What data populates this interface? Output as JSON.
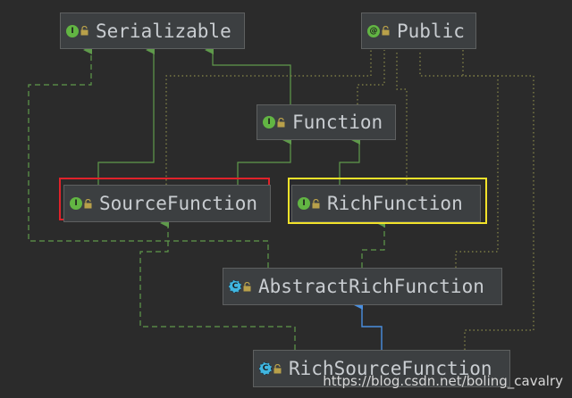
{
  "diagram": {
    "nodes": {
      "serializable": {
        "label": "Serializable",
        "kind": "interface",
        "kind_letter": "I"
      },
      "public": {
        "label": "Public",
        "kind": "annotation",
        "kind_letter": "@"
      },
      "function": {
        "label": "Function",
        "kind": "interface",
        "kind_letter": "I"
      },
      "source_function": {
        "label": "SourceFunction",
        "kind": "interface",
        "kind_letter": "I",
        "highlight": "red"
      },
      "rich_function": {
        "label": "RichFunction",
        "kind": "interface",
        "kind_letter": "I",
        "highlight": "yellow"
      },
      "abstract_rich_function": {
        "label": "AbstractRichFunction",
        "kind": "abstract_class",
        "kind_letter": "C"
      },
      "rich_source_function": {
        "label": "RichSourceFunction",
        "kind": "abstract_class",
        "kind_letter": "C"
      }
    },
    "edges": [
      {
        "from": "function",
        "to": "serializable",
        "style": "solid",
        "color": "#5f9a4b"
      },
      {
        "from": "source_function",
        "to": "serializable",
        "style": "solid",
        "color": "#5f9a4b"
      },
      {
        "from": "source_function",
        "to": "function",
        "style": "solid",
        "color": "#5f9a4b"
      },
      {
        "from": "rich_function",
        "to": "function",
        "style": "solid",
        "color": "#5f9a4b"
      },
      {
        "from": "abstract_rich_function",
        "to": "serializable",
        "style": "dashed",
        "color": "#5f9a4b"
      },
      {
        "from": "abstract_rich_function",
        "to": "rich_function",
        "style": "dashed",
        "color": "#5f9a4b"
      },
      {
        "from": "rich_source_function",
        "to": "source_function",
        "style": "dashed",
        "color": "#5f9a4b"
      },
      {
        "from": "rich_source_function",
        "to": "abstract_rich_function",
        "style": "solid",
        "color": "#4a8fe0"
      },
      {
        "from": "source_function",
        "to": "public",
        "style": "dotted",
        "color": "#8a8a4a"
      },
      {
        "from": "function",
        "to": "public",
        "style": "dotted",
        "color": "#8a8a4a"
      },
      {
        "from": "rich_function",
        "to": "public",
        "style": "dotted",
        "color": "#8a8a4a"
      },
      {
        "from": "abstract_rich_function",
        "to": "public",
        "style": "dotted",
        "color": "#8a8a4a"
      },
      {
        "from": "rich_source_function",
        "to": "public",
        "style": "dotted",
        "color": "#8a8a4a"
      }
    ],
    "colors": {
      "background": "#2b2b2b",
      "node_fill": "#3c3f41",
      "node_border": "#5e6060",
      "text": "#c9cdd1",
      "interface_icon": "#62b543",
      "class_icon": "#40b6e0",
      "inherit_solid": "#5f9a4b",
      "inherit_class": "#4a8fe0",
      "annotation_dotted": "#8a8a4a",
      "highlight_red": "#e0222a",
      "highlight_yellow": "#f2e22a"
    }
  },
  "watermark": "https://blog.csdn.net/boling_cavalry"
}
